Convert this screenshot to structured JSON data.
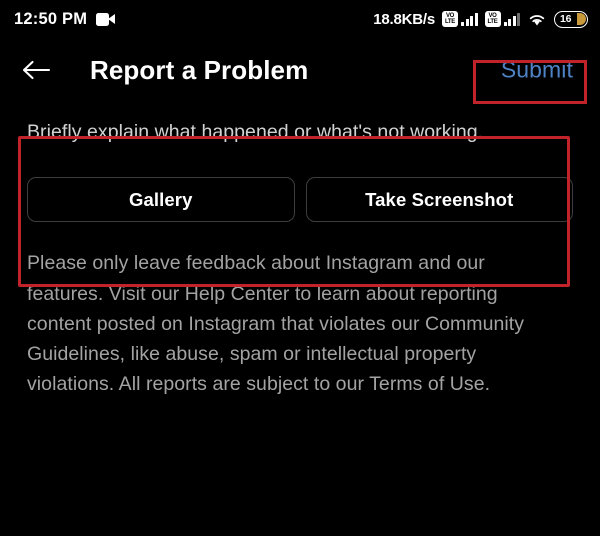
{
  "status_bar": {
    "clock": "12:50 PM",
    "video_icon": "video-camera-icon",
    "net_speed": "18.8KB/s",
    "sim1_label_top": "VO",
    "sim1_label_bottom": "LTE",
    "sim2_label_top": "VO",
    "sim2_label_bottom": "LTE",
    "wifi_icon": "wifi-icon",
    "battery_level": "16"
  },
  "header": {
    "back_icon": "back-arrow-icon",
    "title": "Report a Problem",
    "submit_label": "Submit",
    "submit_color": "#4f82c4"
  },
  "main": {
    "input_placeholder": "Briefly explain what happened or what's not working.",
    "input_value": "",
    "gallery_label": "Gallery",
    "screenshot_label": "Take Screenshot",
    "disclaimer": "Please only leave feedback about Instagram and our features. Visit our Help Center to learn about reporting content posted on Instagram that violates our Community Guidelines, like abuse, spam or intellectual property violations. All reports are subject to our Terms of Use."
  },
  "annotations": {
    "accent_color": "#c1232b",
    "submit_highlight": "submit-button-highlight",
    "input_highlight": "report-input-area-highlight"
  }
}
